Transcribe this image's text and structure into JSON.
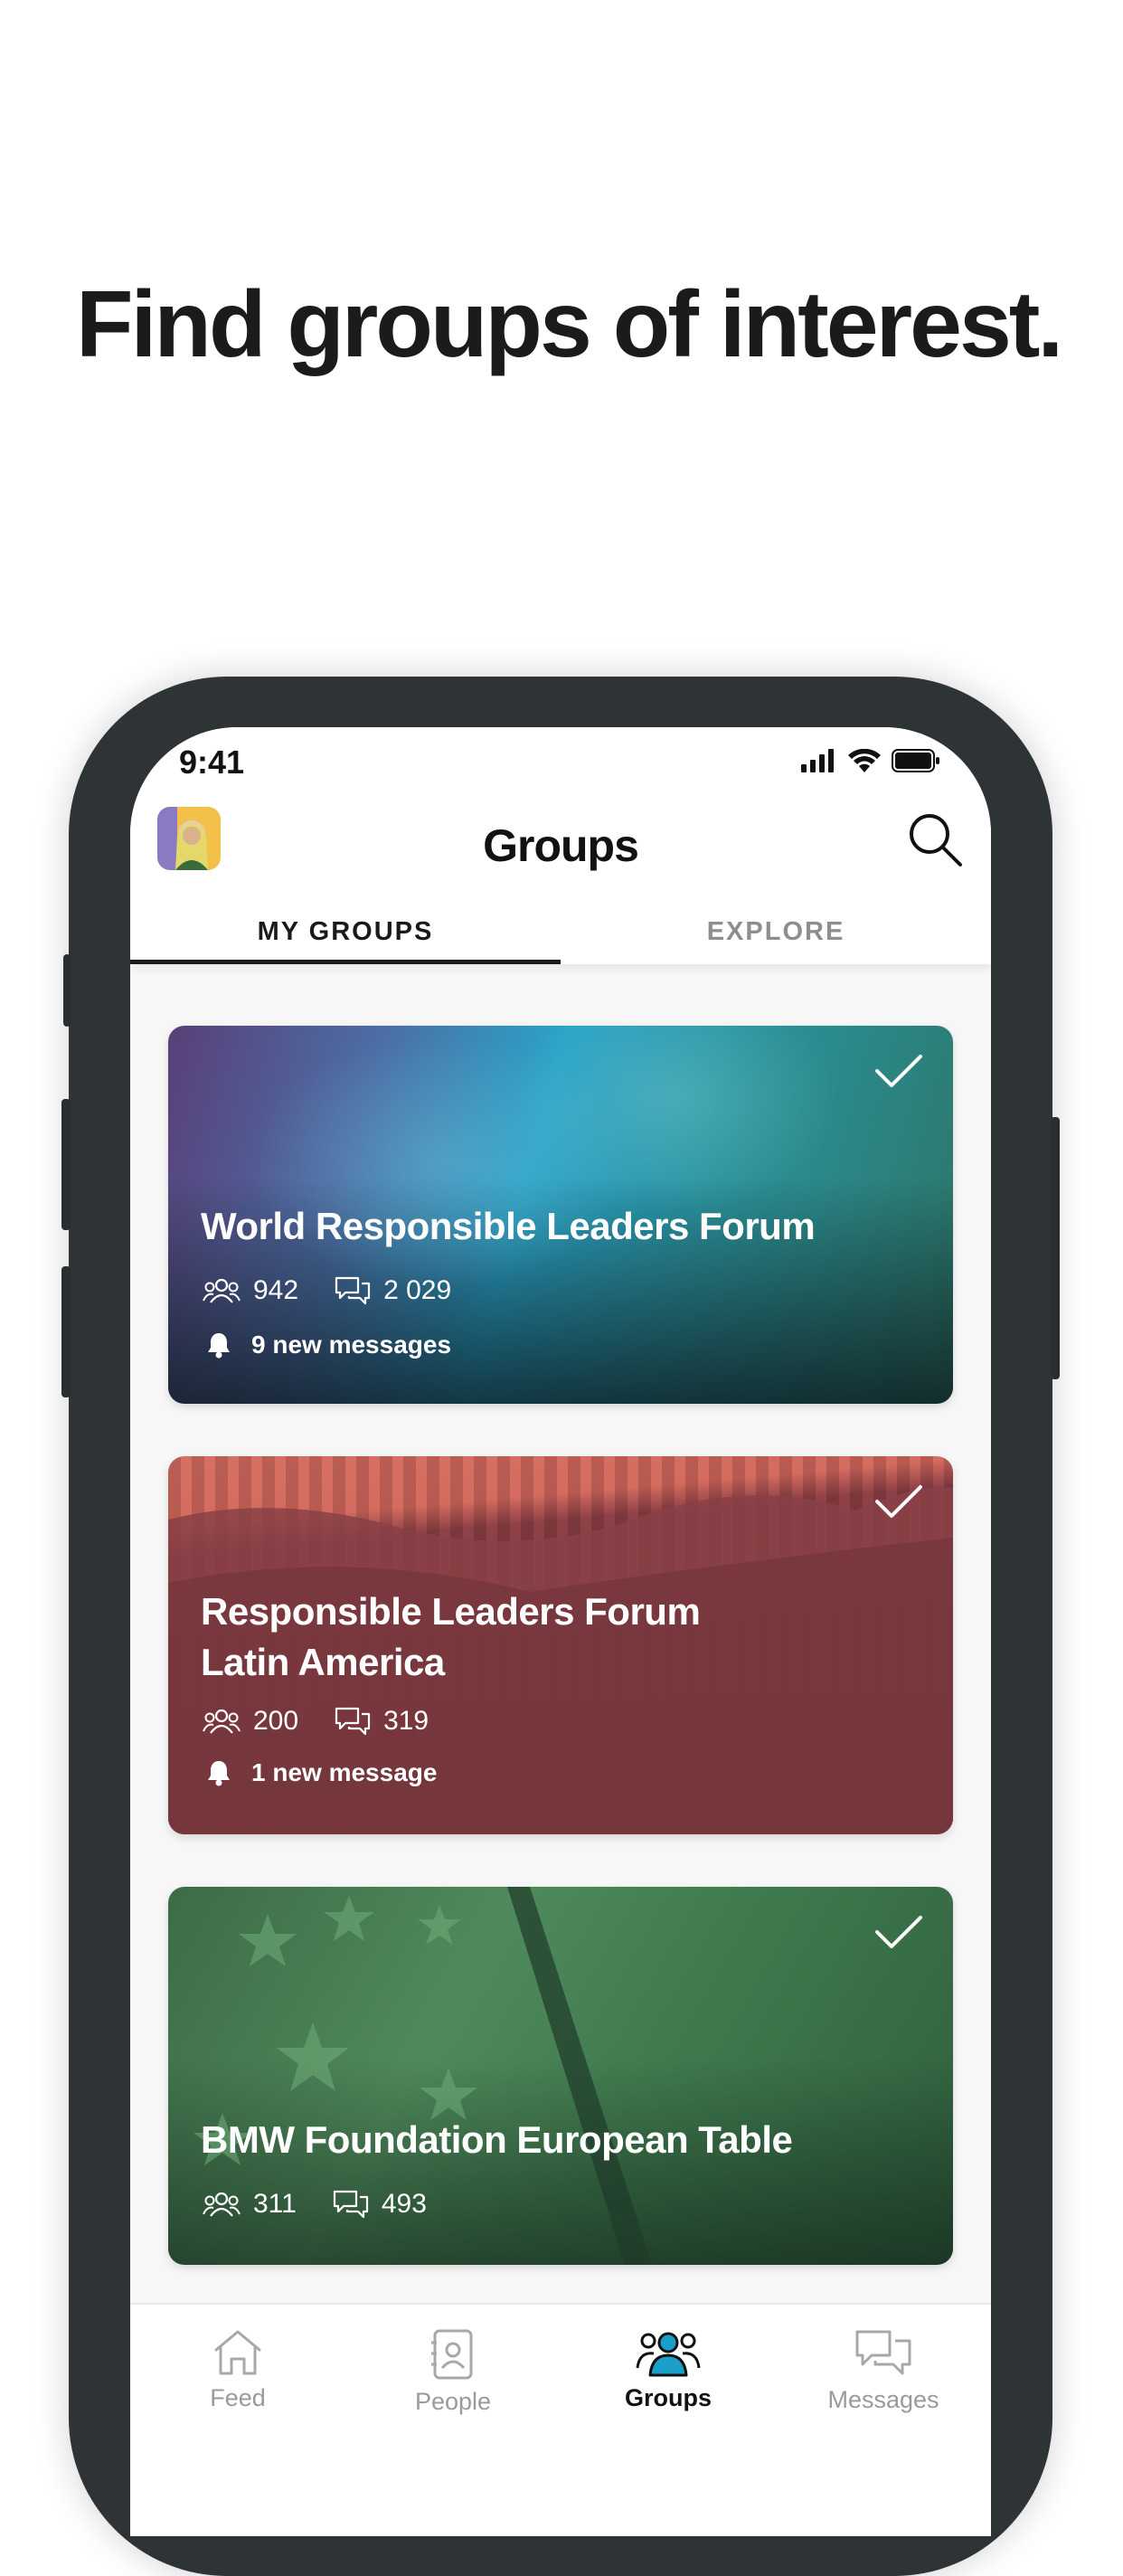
{
  "headline": "Find groups of interest.",
  "status_bar": {
    "time": "9:41"
  },
  "header": {
    "title": "Groups"
  },
  "tabs": [
    {
      "label": "MY GROUPS",
      "active": true
    },
    {
      "label": "EXPLORE",
      "active": false
    }
  ],
  "groups": [
    {
      "title": "World Responsible Leaders Forum",
      "members": "942",
      "posts": "2 029",
      "notification": "9 new messages",
      "joined": true
    },
    {
      "title_line1": "Responsible Leaders Forum",
      "title_line2": "Latin America",
      "members": "200",
      "posts": "319",
      "notification": "1 new message",
      "joined": true
    },
    {
      "title": "BMW Foundation European Table",
      "members": "311",
      "posts": "493",
      "joined": true
    }
  ],
  "bottom_nav": [
    {
      "label": "Feed",
      "icon": "home-icon",
      "active": false
    },
    {
      "label": "People",
      "icon": "contacts-icon",
      "active": false
    },
    {
      "label": "Groups",
      "icon": "groups-icon",
      "active": true
    },
    {
      "label": "Messages",
      "icon": "messages-icon",
      "active": false
    }
  ],
  "colors": {
    "accent": "#1aa0c8",
    "text": "#111111",
    "inactive": "#9a9a9a"
  }
}
